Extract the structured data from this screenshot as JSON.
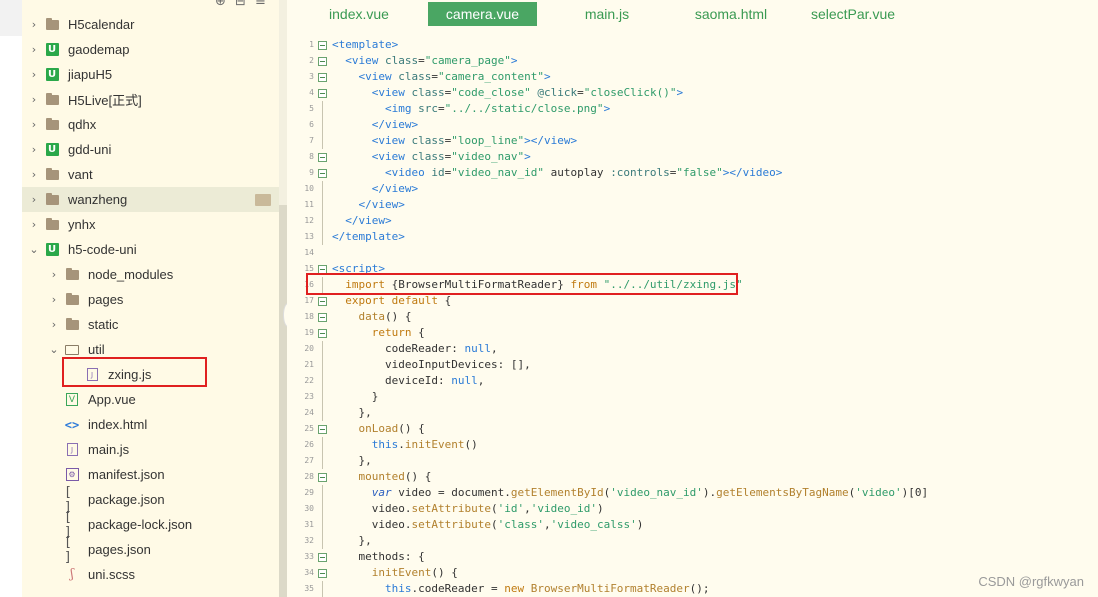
{
  "tabs": [
    {
      "label": "index.vue",
      "active": false
    },
    {
      "label": "camera.vue",
      "active": true
    },
    {
      "label": "main.js",
      "active": false
    },
    {
      "label": "saoma.html",
      "active": false
    },
    {
      "label": "selectPar.vue",
      "active": false
    }
  ],
  "sidebar": {
    "toolbar_icons": [
      "target-icon",
      "collapse-icon",
      "menu-icon"
    ],
    "items": [
      {
        "label": "H5calendar",
        "icon": "folder-icon",
        "expanded": false
      },
      {
        "label": "gaodemap",
        "icon": "uniapp-project-icon",
        "expanded": false
      },
      {
        "label": "jiapuH5",
        "icon": "uniapp-project-icon",
        "expanded": false
      },
      {
        "label": "H5Live[正式]",
        "icon": "folder-icon",
        "expanded": false
      },
      {
        "label": "qdhx",
        "icon": "folder-icon",
        "expanded": false
      },
      {
        "label": "gdd-uni",
        "icon": "uniapp-project-icon",
        "expanded": false
      },
      {
        "label": "vant",
        "icon": "folder-icon",
        "expanded": false
      },
      {
        "label": "wanzheng",
        "icon": "folder-icon",
        "expanded": false,
        "selected": true
      },
      {
        "label": "ynhx",
        "icon": "folder-icon",
        "expanded": false
      },
      {
        "label": "h5-code-uni",
        "icon": "uniapp-project-icon",
        "expanded": true
      },
      {
        "label": "node_modules",
        "icon": "folder-icon",
        "expanded": false
      },
      {
        "label": "pages",
        "icon": "folder-icon",
        "expanded": false
      },
      {
        "label": "static",
        "icon": "folder-icon",
        "expanded": false
      },
      {
        "label": "util",
        "icon": "folder-open-icon",
        "expanded": true
      },
      {
        "label": "zxing.js",
        "icon": "js-file-icon"
      },
      {
        "label": "App.vue",
        "icon": "vue-file-icon"
      },
      {
        "label": "index.html",
        "icon": "html-file-icon"
      },
      {
        "label": "main.js",
        "icon": "js-file-icon"
      },
      {
        "label": "manifest.json",
        "icon": "manifest-file-icon"
      },
      {
        "label": "package.json",
        "icon": "json-file-icon"
      },
      {
        "label": "package-lock.json",
        "icon": "json-file-icon"
      },
      {
        "label": "pages.json",
        "icon": "json-file-icon"
      },
      {
        "label": "uni.scss",
        "icon": "scss-file-icon"
      }
    ]
  },
  "code": {
    "lines": [
      "<template>",
      "  <view class=\"camera_page\">",
      "    <view class=\"camera_content\">",
      "      <view class=\"code_close\" @click=\"closeClick()\">",
      "        <img src=\"../../static/close.png\">",
      "      </view>",
      "      <view class=\"loop_line\"></view>",
      "      <view class=\"video_nav\">",
      "        <video id=\"video_nav_id\" autoplay :controls=\"false\"></video>",
      "      </view>",
      "    </view>",
      "  </view>",
      "</template>",
      "",
      "<script>",
      "  import {BrowserMultiFormatReader} from \"../../util/zxing.js\"",
      "  export default {",
      "    data() {",
      "      return {",
      "        codeReader: null,",
      "        videoInputDevices: [],",
      "        deviceId: null,",
      "      }",
      "    },",
      "    onLoad() {",
      "      this.initEvent()",
      "    },",
      "    mounted() {",
      "      var video = document.getElementById('video_nav_id').getElementsByTagName('video')[0]",
      "      video.setAttribute('id','video_id')",
      "      video.setAttribute('class','video_calss')",
      "    },",
      "    methods: {",
      "      initEvent() {",
      "        this.codeReader = new BrowserMultiFormatReader();"
    ],
    "foldable": [
      1,
      2,
      3,
      4,
      8,
      9,
      15,
      17,
      18,
      19,
      25,
      28,
      33,
      34
    ]
  },
  "watermark": "CSDN @rgfkwyan",
  "colors": {
    "accent": "#4aa663",
    "highlight_box": "#e02020",
    "sidebar_bg": "#fffae6",
    "editor_bg": "#fffcee"
  }
}
